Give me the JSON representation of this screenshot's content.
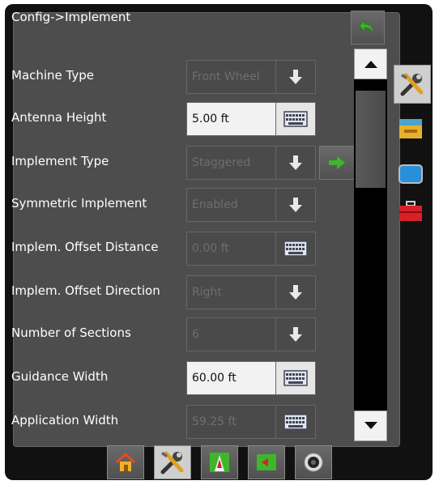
{
  "title": "Config->Implement",
  "rows": [
    {
      "label": "Machine Type",
      "value": "Front Wheel",
      "control": "dropdown",
      "enabled": false
    },
    {
      "label": "Antenna Height",
      "value": "5.00 ft",
      "control": "keyboard",
      "enabled": true
    },
    {
      "label": "Implement Type",
      "value": "Staggered",
      "control": "dropdown",
      "enabled": false
    },
    {
      "label": "Symmetric Implement",
      "value": "Enabled",
      "control": "dropdown",
      "enabled": false
    },
    {
      "label": "Implem. Offset Distance",
      "value": "0.00 ft",
      "control": "keyboard",
      "enabled": false
    },
    {
      "label": "Implem. Offset Direction",
      "value": "Right",
      "control": "dropdown",
      "enabled": false
    },
    {
      "label": "Number of Sections",
      "value": "6",
      "control": "dropdown",
      "enabled": false
    },
    {
      "label": "Guidance Width",
      "value": "60.00 ft",
      "control": "keyboard",
      "enabled": true
    },
    {
      "label": "Application Width",
      "value": "59.25 ft",
      "control": "keyboard",
      "enabled": false
    }
  ],
  "icons": {
    "back": "undo-arrow-icon",
    "dropdown": "down-arrow-icon",
    "keyboard": "keyboard-icon",
    "next": "right-arrow-icon",
    "scroll_up": "triangle-up-icon",
    "scroll_down": "triangle-down-icon"
  },
  "side_tabs": [
    {
      "name": "tools-icon",
      "active": true
    },
    {
      "name": "console-icon",
      "active": false
    },
    {
      "name": "display-icon",
      "active": false
    },
    {
      "name": "toolbox-icon",
      "active": false
    }
  ],
  "bottom_nav": [
    {
      "name": "home-icon",
      "active": false
    },
    {
      "name": "tools-icon",
      "active": true
    },
    {
      "name": "guidance-icon",
      "active": false
    },
    {
      "name": "map-icon",
      "active": false
    },
    {
      "name": "camera-icon",
      "active": false
    }
  ],
  "colors": {
    "accent_green": "#3fb52b",
    "panel": "#4d4d4d",
    "field_editable": "#f2f2f2"
  }
}
